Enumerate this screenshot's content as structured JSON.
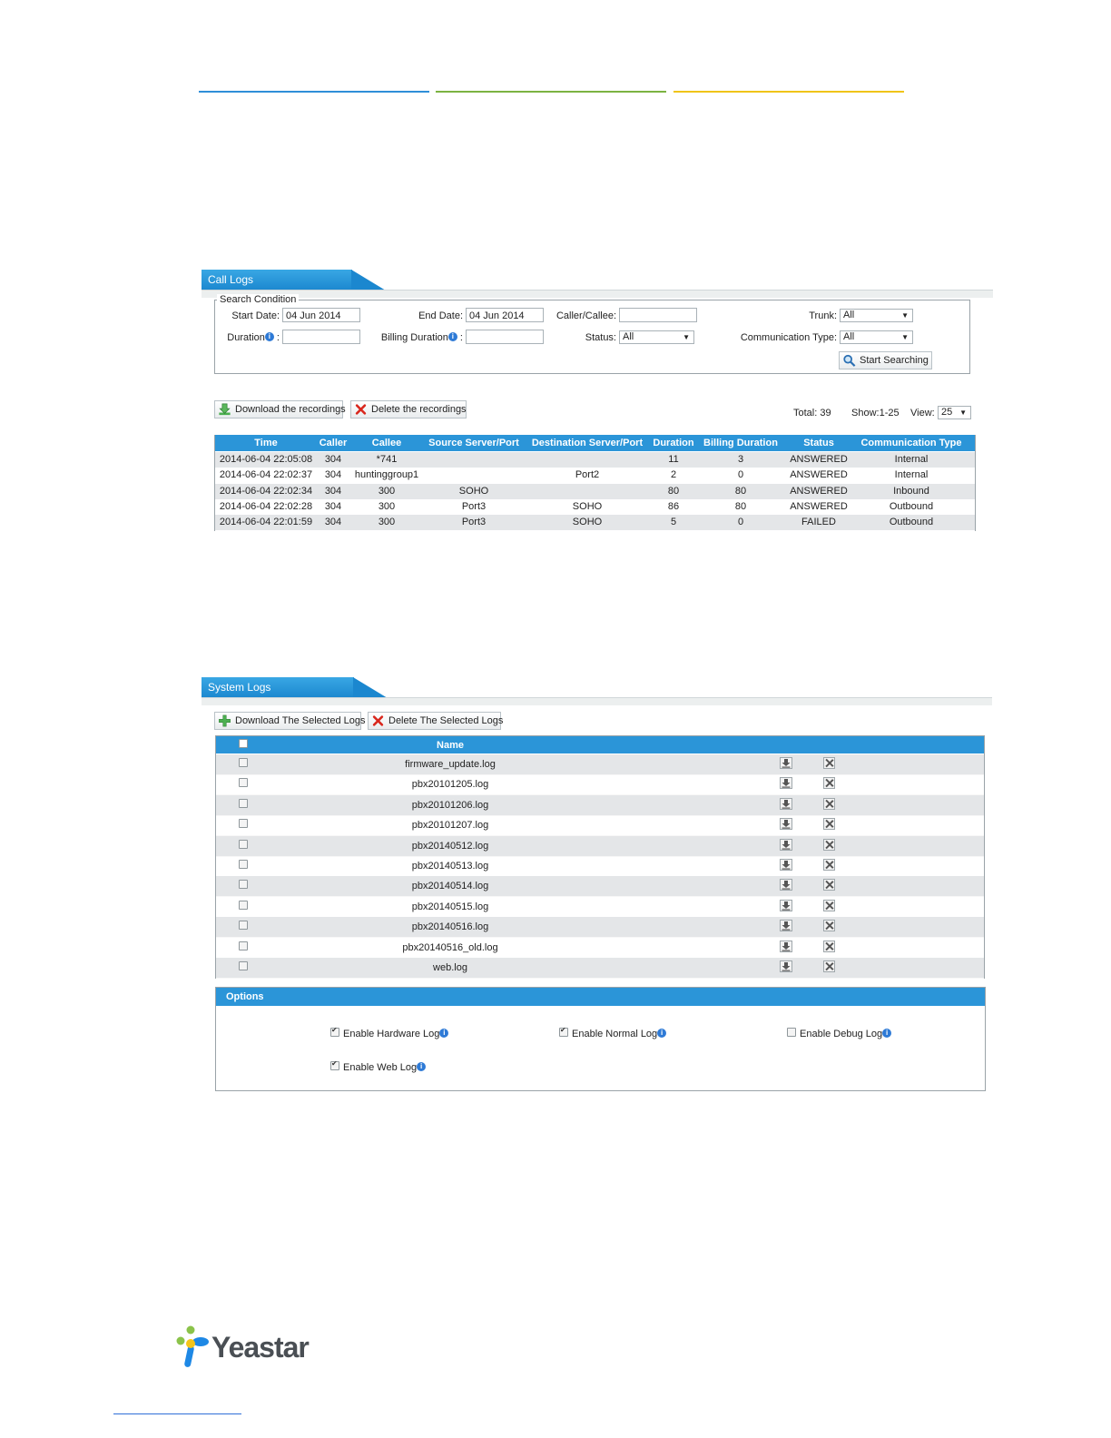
{
  "header_lines": {
    "colors": [
      "#2f8fd8",
      "#7cb342",
      "#f0c419"
    ]
  },
  "call_logs": {
    "tab_title": "Call Logs",
    "search": {
      "legend": "Search Condition",
      "start_date_label": "Start Date:",
      "start_date_value": "04 Jun 2014",
      "end_date_label": "End Date:",
      "end_date_value": "04 Jun 2014",
      "caller_callee_label": "Caller/Callee:",
      "caller_callee_value": "",
      "trunk_label": "Trunk:",
      "trunk_value": "All",
      "duration_label": "Duration",
      "duration_value": "",
      "billing_duration_label": "Billing Duration",
      "billing_duration_value": "",
      "status_label": "Status:",
      "status_value": "All",
      "comm_type_label": "Communication Type:",
      "comm_type_value": "All",
      "start_searching": "Start Searching"
    },
    "download_recordings": "Download the recordings",
    "delete_recordings": "Delete the recordings",
    "total": "Total: 39",
    "show": "Show:1-25",
    "view_label": "View:",
    "view_value": "25",
    "columns": [
      "Time",
      "Caller",
      "Callee",
      "Source Server/Port",
      "Destination Server/Port",
      "Duration",
      "Billing Duration",
      "Status",
      "Communication Type"
    ],
    "rows": [
      [
        "2014-06-04 22:05:08",
        "304",
        "*741",
        "",
        "",
        "11",
        "3",
        "ANSWERED",
        "Internal"
      ],
      [
        "2014-06-04 22:02:37",
        "304",
        "huntinggroup1",
        "",
        "Port2",
        "2",
        "0",
        "ANSWERED",
        "Internal"
      ],
      [
        "2014-06-04 22:02:34",
        "304",
        "300",
        "SOHO",
        "",
        "80",
        "80",
        "ANSWERED",
        "Inbound"
      ],
      [
        "2014-06-04 22:02:28",
        "304",
        "300",
        "Port3",
        "SOHO",
        "86",
        "80",
        "ANSWERED",
        "Outbound"
      ],
      [
        "2014-06-04 22:01:59",
        "304",
        "300",
        "Port3",
        "SOHO",
        "5",
        "0",
        "FAILED",
        "Outbound"
      ]
    ]
  },
  "system_logs": {
    "tab_title": "System Logs",
    "download_selected": "Download The Selected Logs",
    "delete_selected": "Delete The Selected Logs",
    "name_header": "Name",
    "files": [
      "firmware_update.log",
      "pbx20101205.log",
      "pbx20101206.log",
      "pbx20101207.log",
      "pbx20140512.log",
      "pbx20140513.log",
      "pbx20140514.log",
      "pbx20140515.log",
      "pbx20140516.log",
      "pbx20140516_old.log",
      "web.log"
    ],
    "options": {
      "title": "Options",
      "hardware_log": "Enable Hardware Log",
      "hardware_checked": true,
      "normal_log": "Enable Normal Log",
      "normal_checked": true,
      "debug_log": "Enable Debug Log",
      "debug_checked": false,
      "web_log": "Enable Web Log",
      "web_checked": true
    }
  },
  "footer": {
    "logo_text": "Yeastar"
  }
}
